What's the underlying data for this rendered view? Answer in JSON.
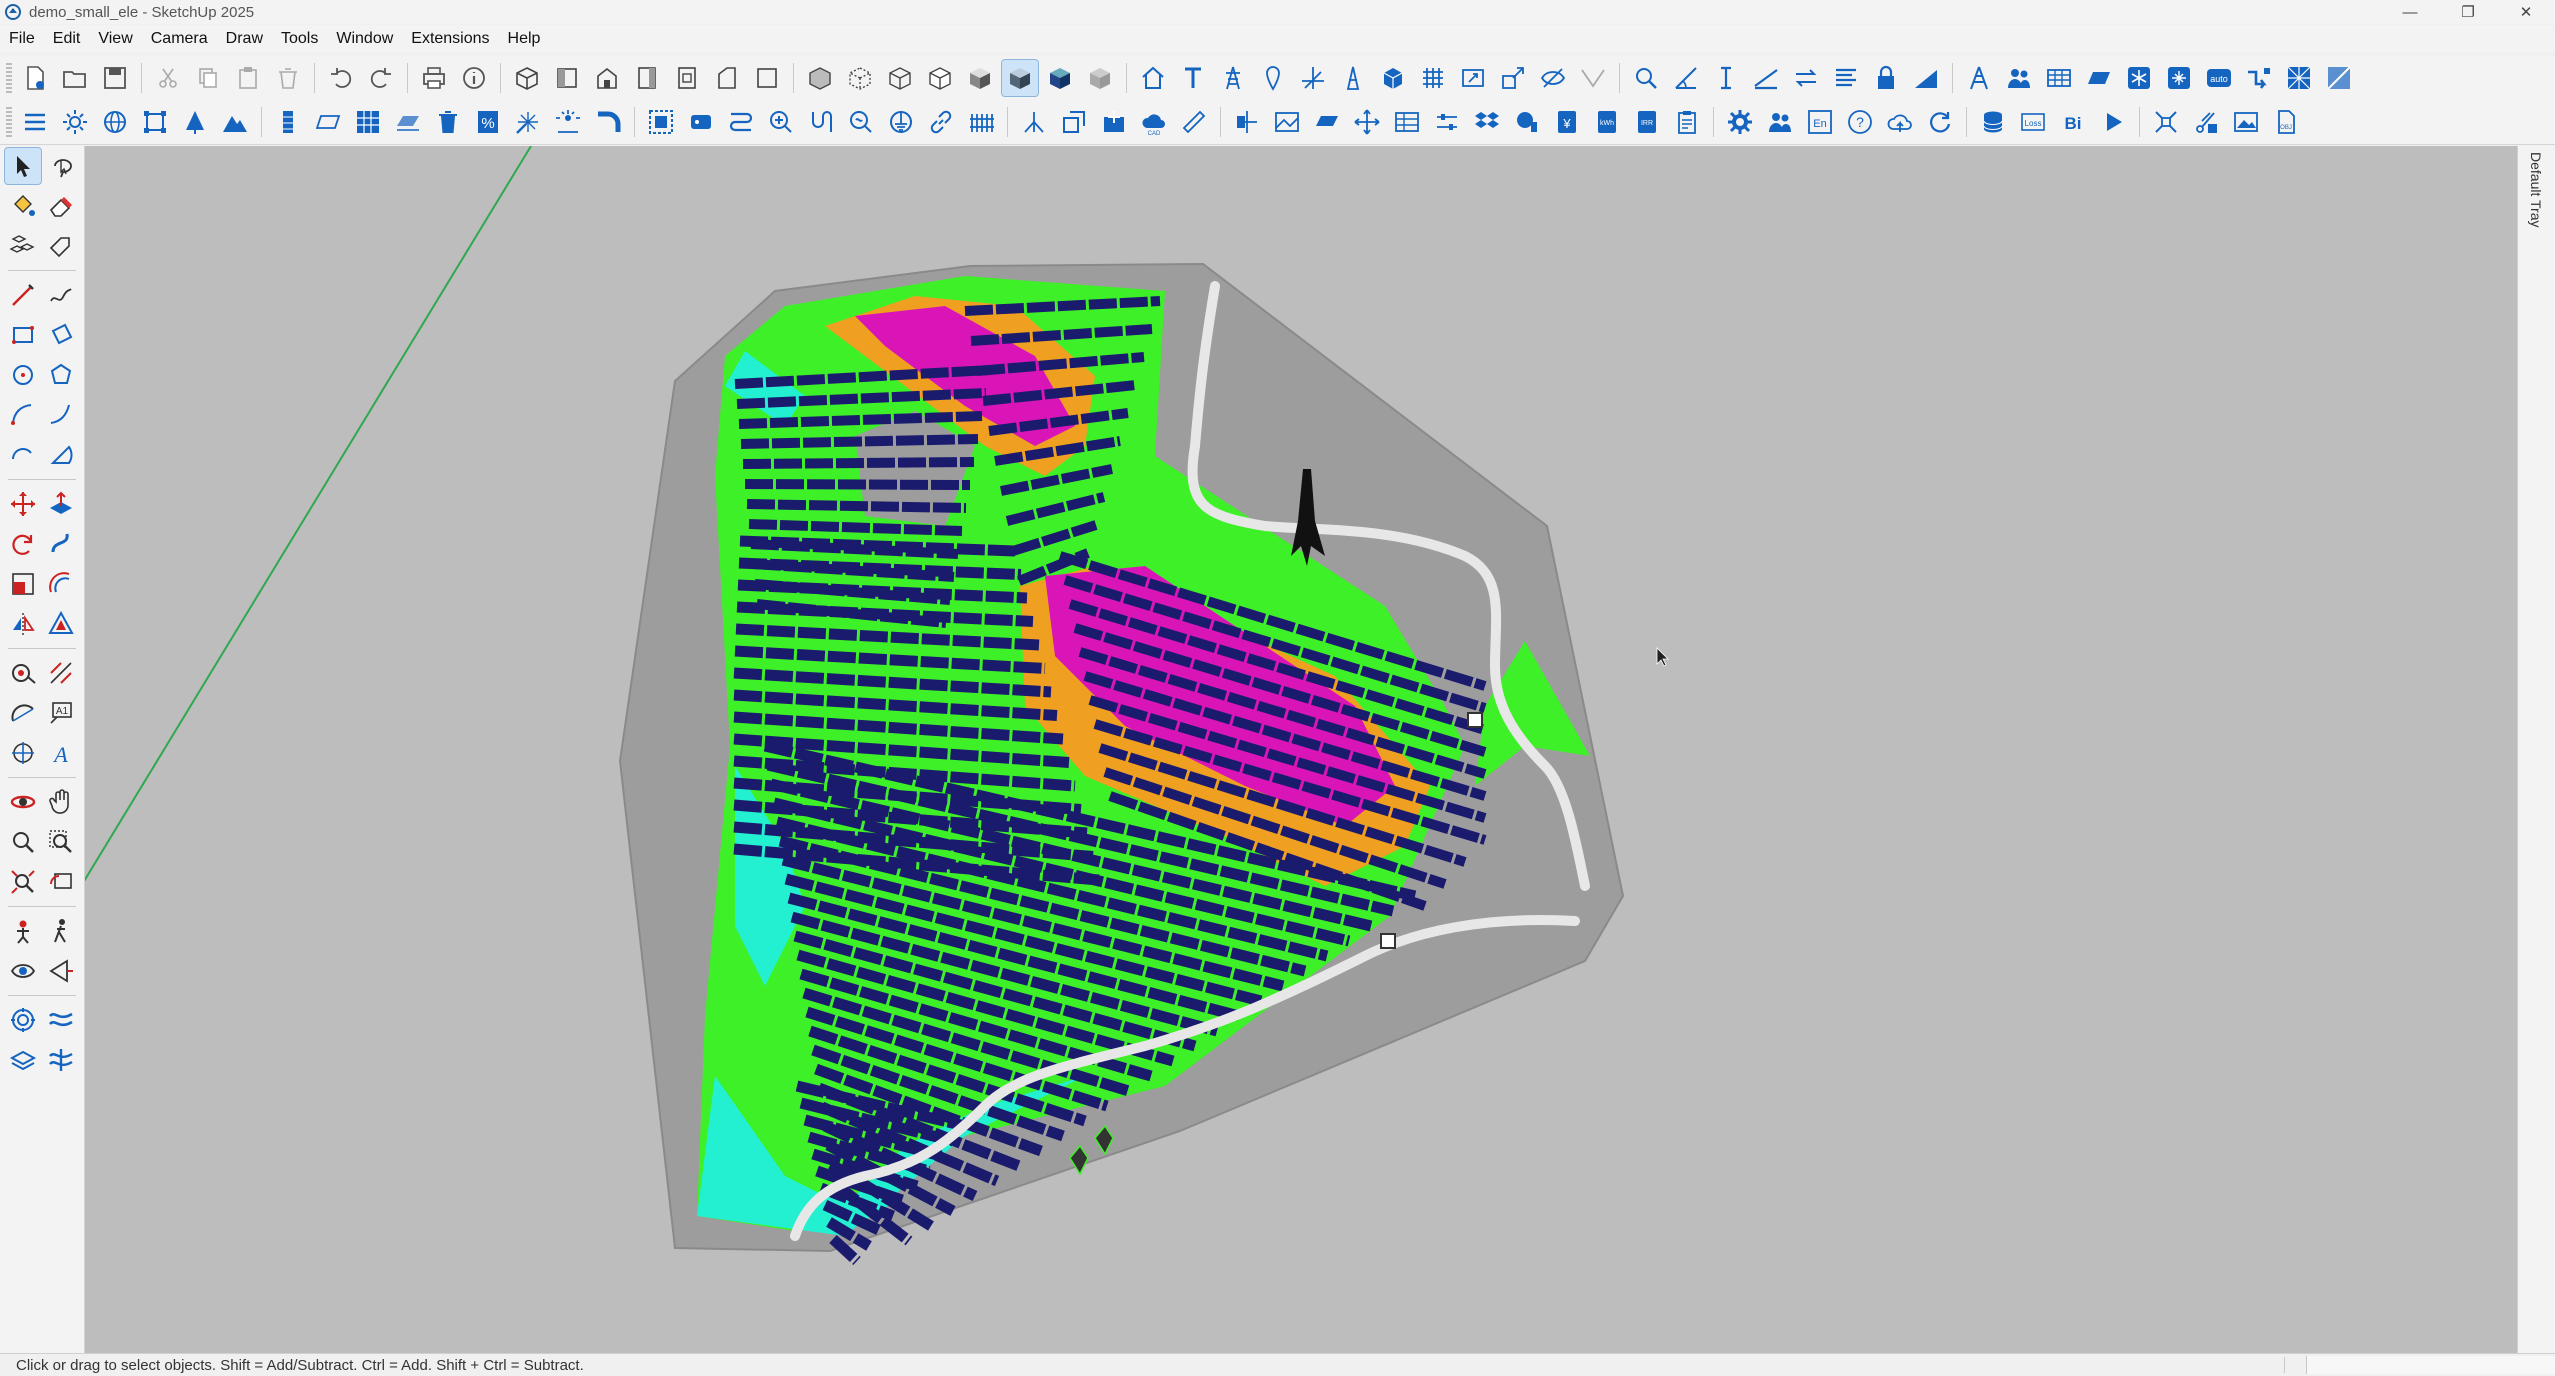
{
  "window": {
    "title": "demo_small_ele - SketchUp 2025",
    "minimize": "—",
    "maximize": "❐",
    "close": "✕"
  },
  "menu": [
    "File",
    "Edit",
    "View",
    "Camera",
    "Draw",
    "Tools",
    "Window",
    "Extensions",
    "Help"
  ],
  "toolbar_labels": {
    "auto": "auto",
    "en": "En",
    "kwh": "kWh",
    "irr": "IRR",
    "loss": "Loss",
    "bi": "Bi"
  },
  "tray": {
    "label": "Default Tray"
  },
  "status": {
    "text": "Click or drag to select objects. Shift = Add/Subtract. Ctrl = Add. Shift + Ctrl = Subtract."
  },
  "colors": {
    "accent_blue": "#1565c0",
    "panel_navy": "#1b1b6e",
    "terrain_green": "#3ef027",
    "terrain_cyan": "#23f0d0",
    "terrain_magenta": "#d915b8",
    "terrain_orange": "#f0a020",
    "viewport_bg": "#bdbdbd"
  }
}
